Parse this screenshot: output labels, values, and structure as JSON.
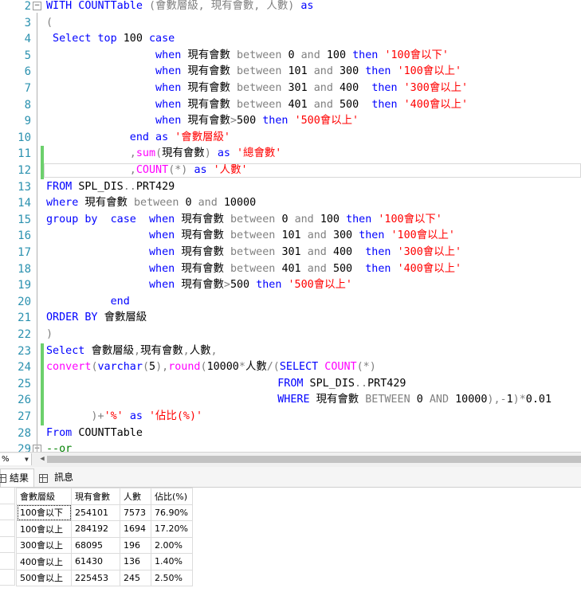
{
  "editor": {
    "lines": [
      {
        "n": "2",
        "parts": [
          {
            "t": "WITH COUNTTable ",
            "c": "kw"
          },
          {
            "t": "(會數層級, 現有會數, 人數) ",
            "c": "gr"
          },
          {
            "t": "as",
            "c": "kw"
          }
        ]
      },
      {
        "n": "3",
        "parts": [
          {
            "t": "(",
            "c": "gr"
          }
        ]
      },
      {
        "n": "4",
        "parts": [
          {
            "t": " Select top ",
            "c": "kw"
          },
          {
            "t": "100 ",
            "c": "pl"
          },
          {
            "t": "case",
            "c": "kw"
          }
        ]
      },
      {
        "n": "5",
        "parts": [
          {
            "t": "                 when ",
            "c": "kw"
          },
          {
            "t": "現有會數 ",
            "c": "pl"
          },
          {
            "t": "between ",
            "c": "gr"
          },
          {
            "t": "0 ",
            "c": "pl"
          },
          {
            "t": "and ",
            "c": "gr"
          },
          {
            "t": "100 ",
            "c": "pl"
          },
          {
            "t": "then ",
            "c": "kw"
          },
          {
            "t": "'100會以下'",
            "c": "str"
          }
        ]
      },
      {
        "n": "6",
        "parts": [
          {
            "t": "                 when ",
            "c": "kw"
          },
          {
            "t": "現有會數 ",
            "c": "pl"
          },
          {
            "t": "between ",
            "c": "gr"
          },
          {
            "t": "101 ",
            "c": "pl"
          },
          {
            "t": "and ",
            "c": "gr"
          },
          {
            "t": "300 ",
            "c": "pl"
          },
          {
            "t": "then ",
            "c": "kw"
          },
          {
            "t": "'100會以上'",
            "c": "str"
          }
        ]
      },
      {
        "n": "7",
        "parts": [
          {
            "t": "                 when ",
            "c": "kw"
          },
          {
            "t": "現有會數 ",
            "c": "pl"
          },
          {
            "t": "between ",
            "c": "gr"
          },
          {
            "t": "301 ",
            "c": "pl"
          },
          {
            "t": "and ",
            "c": "gr"
          },
          {
            "t": "400  ",
            "c": "pl"
          },
          {
            "t": "then ",
            "c": "kw"
          },
          {
            "t": "'300會以上'",
            "c": "str"
          }
        ]
      },
      {
        "n": "8",
        "parts": [
          {
            "t": "                 when ",
            "c": "kw"
          },
          {
            "t": "現有會數 ",
            "c": "pl"
          },
          {
            "t": "between ",
            "c": "gr"
          },
          {
            "t": "401 ",
            "c": "pl"
          },
          {
            "t": "and ",
            "c": "gr"
          },
          {
            "t": "500  ",
            "c": "pl"
          },
          {
            "t": "then ",
            "c": "kw"
          },
          {
            "t": "'400會以上'",
            "c": "str"
          }
        ]
      },
      {
        "n": "9",
        "parts": [
          {
            "t": "                 when ",
            "c": "kw"
          },
          {
            "t": "現有會數",
            "c": "pl"
          },
          {
            "t": ">",
            "c": "gr"
          },
          {
            "t": "500 ",
            "c": "pl"
          },
          {
            "t": "then ",
            "c": "kw"
          },
          {
            "t": "'500會以上'",
            "c": "str"
          }
        ]
      },
      {
        "n": "10",
        "parts": [
          {
            "t": "             end as ",
            "c": "kw"
          },
          {
            "t": "'會數層級'",
            "c": "str"
          }
        ]
      },
      {
        "n": "11",
        "parts": [
          {
            "t": "             ,",
            "c": "gr"
          },
          {
            "t": "sum",
            "c": "fn"
          },
          {
            "t": "(",
            "c": "gr"
          },
          {
            "t": "現有會數",
            "c": "pl"
          },
          {
            "t": ") ",
            "c": "gr"
          },
          {
            "t": "as ",
            "c": "kw"
          },
          {
            "t": "'總會數'",
            "c": "str"
          }
        ]
      },
      {
        "n": "12",
        "parts": [
          {
            "t": "             ,",
            "c": "gr"
          },
          {
            "t": "COUNT",
            "c": "fn"
          },
          {
            "t": "(*) ",
            "c": "gr"
          },
          {
            "t": "as ",
            "c": "kw"
          },
          {
            "t": "'人數'",
            "c": "str"
          }
        ]
      },
      {
        "n": "13",
        "parts": [
          {
            "t": "FROM ",
            "c": "kw"
          },
          {
            "t": "SPL_DIS",
            "c": "pl"
          },
          {
            "t": "..",
            "c": "gr"
          },
          {
            "t": "PRT429",
            "c": "pl"
          }
        ]
      },
      {
        "n": "14",
        "parts": [
          {
            "t": "where ",
            "c": "kw"
          },
          {
            "t": "現有會數 ",
            "c": "pl"
          },
          {
            "t": "between ",
            "c": "gr"
          },
          {
            "t": "0 ",
            "c": "pl"
          },
          {
            "t": "and ",
            "c": "gr"
          },
          {
            "t": "10000",
            "c": "pl"
          }
        ]
      },
      {
        "n": "15",
        "parts": [
          {
            "t": "group by  case  when ",
            "c": "kw"
          },
          {
            "t": "現有會數 ",
            "c": "pl"
          },
          {
            "t": "between ",
            "c": "gr"
          },
          {
            "t": "0 ",
            "c": "pl"
          },
          {
            "t": "and ",
            "c": "gr"
          },
          {
            "t": "100 ",
            "c": "pl"
          },
          {
            "t": "then ",
            "c": "kw"
          },
          {
            "t": "'100會以下'",
            "c": "str"
          }
        ]
      },
      {
        "n": "16",
        "parts": [
          {
            "t": "                when ",
            "c": "kw"
          },
          {
            "t": "現有會數 ",
            "c": "pl"
          },
          {
            "t": "between ",
            "c": "gr"
          },
          {
            "t": "101 ",
            "c": "pl"
          },
          {
            "t": "and ",
            "c": "gr"
          },
          {
            "t": "300 ",
            "c": "pl"
          },
          {
            "t": "then ",
            "c": "kw"
          },
          {
            "t": "'100會以上'",
            "c": "str"
          }
        ]
      },
      {
        "n": "17",
        "parts": [
          {
            "t": "                when ",
            "c": "kw"
          },
          {
            "t": "現有會數 ",
            "c": "pl"
          },
          {
            "t": "between ",
            "c": "gr"
          },
          {
            "t": "301 ",
            "c": "pl"
          },
          {
            "t": "and ",
            "c": "gr"
          },
          {
            "t": "400  ",
            "c": "pl"
          },
          {
            "t": "then ",
            "c": "kw"
          },
          {
            "t": "'300會以上'",
            "c": "str"
          }
        ]
      },
      {
        "n": "18",
        "parts": [
          {
            "t": "                when ",
            "c": "kw"
          },
          {
            "t": "現有會數 ",
            "c": "pl"
          },
          {
            "t": "between ",
            "c": "gr"
          },
          {
            "t": "401 ",
            "c": "pl"
          },
          {
            "t": "and ",
            "c": "gr"
          },
          {
            "t": "500  ",
            "c": "pl"
          },
          {
            "t": "then ",
            "c": "kw"
          },
          {
            "t": "'400會以上'",
            "c": "str"
          }
        ]
      },
      {
        "n": "19",
        "parts": [
          {
            "t": "                when ",
            "c": "kw"
          },
          {
            "t": "現有會數",
            "c": "pl"
          },
          {
            "t": ">",
            "c": "gr"
          },
          {
            "t": "500 ",
            "c": "pl"
          },
          {
            "t": "then ",
            "c": "kw"
          },
          {
            "t": "'500會以上'",
            "c": "str"
          }
        ]
      },
      {
        "n": "20",
        "parts": [
          {
            "t": "          end",
            "c": "kw"
          }
        ]
      },
      {
        "n": "21",
        "parts": [
          {
            "t": "ORDER BY ",
            "c": "kw"
          },
          {
            "t": "會數層級",
            "c": "pl"
          }
        ]
      },
      {
        "n": "22",
        "parts": [
          {
            "t": ")",
            "c": "gr"
          }
        ]
      },
      {
        "n": "23",
        "parts": [
          {
            "t": "Select ",
            "c": "kw"
          },
          {
            "t": "會數層級",
            "c": "pl"
          },
          {
            "t": ",",
            "c": "gr"
          },
          {
            "t": "現有會數",
            "c": "pl"
          },
          {
            "t": ",",
            "c": "gr"
          },
          {
            "t": "人數",
            "c": "pl"
          },
          {
            "t": ",",
            "c": "gr"
          }
        ]
      },
      {
        "n": "24",
        "parts": [
          {
            "t": "convert",
            "c": "fn"
          },
          {
            "t": "(",
            "c": "gr"
          },
          {
            "t": "varchar",
            "c": "kw"
          },
          {
            "t": "(",
            "c": "gr"
          },
          {
            "t": "5",
            "c": "pl"
          },
          {
            "t": "),",
            "c": "gr"
          },
          {
            "t": "round",
            "c": "fn"
          },
          {
            "t": "(",
            "c": "gr"
          },
          {
            "t": "10000",
            "c": "pl"
          },
          {
            "t": "*",
            "c": "gr"
          },
          {
            "t": "人數",
            "c": "pl"
          },
          {
            "t": "/(",
            "c": "gr"
          },
          {
            "t": "SELECT ",
            "c": "kw"
          },
          {
            "t": "COUNT",
            "c": "fn"
          },
          {
            "t": "(*)",
            "c": "gr"
          }
        ]
      },
      {
        "n": "25",
        "parts": [
          {
            "t": "                                    FROM ",
            "c": "kw"
          },
          {
            "t": "SPL_DIS",
            "c": "pl"
          },
          {
            "t": "..",
            "c": "gr"
          },
          {
            "t": "PRT429",
            "c": "pl"
          }
        ]
      },
      {
        "n": "26",
        "parts": [
          {
            "t": "                                    WHERE ",
            "c": "kw"
          },
          {
            "t": "現有會數 ",
            "c": "pl"
          },
          {
            "t": "BETWEEN ",
            "c": "gr"
          },
          {
            "t": "0 ",
            "c": "pl"
          },
          {
            "t": "AND ",
            "c": "gr"
          },
          {
            "t": "10000",
            "c": "pl"
          },
          {
            "t": "),-",
            "c": "gr"
          },
          {
            "t": "1",
            "c": "pl"
          },
          {
            "t": ")*",
            "c": "gr"
          },
          {
            "t": "0.01",
            "c": "pl"
          }
        ]
      },
      {
        "n": "27",
        "parts": [
          {
            "t": "       )+",
            "c": "gr"
          },
          {
            "t": "'%' ",
            "c": "str"
          },
          {
            "t": "as ",
            "c": "kw"
          },
          {
            "t": "'佔比(%)'",
            "c": "str"
          }
        ]
      },
      {
        "n": "28",
        "parts": [
          {
            "t": "From ",
            "c": "kw"
          },
          {
            "t": "COUNTTable",
            "c": "pl"
          }
        ]
      },
      {
        "n": "29",
        "parts": [
          {
            "t": "--or",
            "c": "cm"
          }
        ]
      }
    ]
  },
  "statusbar": {
    "zoom": "%"
  },
  "tabs": {
    "results_label": "結果",
    "messages_label": "訊息"
  },
  "grid": {
    "columns": [
      "會數層級",
      "現有會數",
      "人數",
      "佔比(%)"
    ],
    "rows": [
      [
        "100會以下",
        "254101",
        "7573",
        "76.90%"
      ],
      [
        "100會以上",
        "284192",
        "1694",
        "17.20%"
      ],
      [
        "300會以上",
        "68095",
        "196",
        "2.00%"
      ],
      [
        "400會以上",
        "61430",
        "136",
        "1.40%"
      ],
      [
        "500會以上",
        "225453",
        "245",
        "2.50%"
      ]
    ]
  },
  "colors": {
    "keyword": "#0000ff",
    "string": "#ff0000",
    "operator": "#808080",
    "function": "#ff00ff",
    "line_number": "#2b91af",
    "changed_bar": "#6cd06c"
  }
}
